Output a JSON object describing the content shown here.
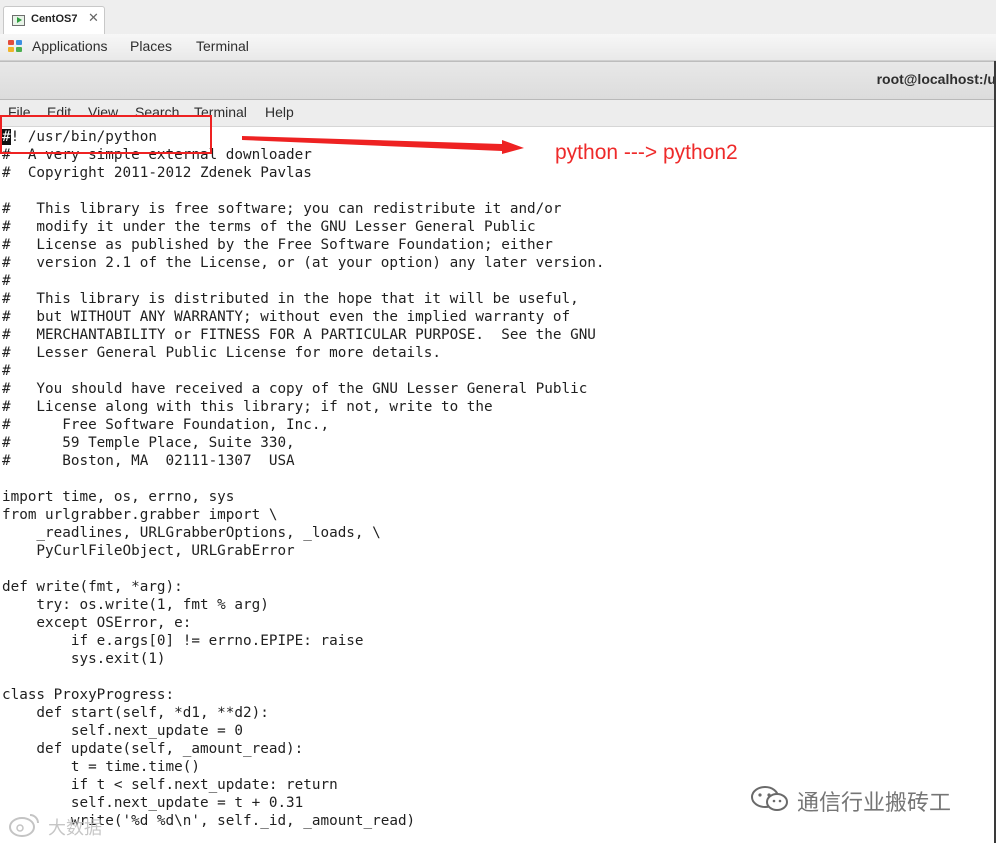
{
  "vm_tab": {
    "label": "CentOS7",
    "close_glyph": "✕"
  },
  "panel": {
    "applications": "Applications",
    "places": "Places",
    "terminal": "Terminal"
  },
  "window": {
    "title": "root@localhost:/u"
  },
  "menu": [
    "File",
    "Edit",
    "View",
    "Search",
    "Terminal",
    "Help"
  ],
  "terminal": {
    "cursor_char": "#",
    "lines": [
      "! /usr/bin/python",
      "#  A very simple external downloader",
      "#  Copyright 2011-2012 Zdenek Pavlas",
      "",
      "#   This library is free software; you can redistribute it and/or",
      "#   modify it under the terms of the GNU Lesser General Public",
      "#   License as published by the Free Software Foundation; either",
      "#   version 2.1 of the License, or (at your option) any later version.",
      "#",
      "#   This library is distributed in the hope that it will be useful,",
      "#   but WITHOUT ANY WARRANTY; without even the implied warranty of",
      "#   MERCHANTABILITY or FITNESS FOR A PARTICULAR PURPOSE.  See the GNU",
      "#   Lesser General Public License for more details.",
      "#",
      "#   You should have received a copy of the GNU Lesser General Public",
      "#   License along with this library; if not, write to the",
      "#      Free Software Foundation, Inc.,",
      "#      59 Temple Place, Suite 330,",
      "#      Boston, MA  02111-1307  USA",
      "",
      "import time, os, errno, sys",
      "from urlgrabber.grabber import \\",
      "    _readlines, URLGrabberOptions, _loads, \\",
      "    PyCurlFileObject, URLGrabError",
      "",
      "def write(fmt, *arg):",
      "    try: os.write(1, fmt % arg)",
      "    except OSError, e:",
      "        if e.args[0] != errno.EPIPE: raise",
      "        sys.exit(1)",
      "",
      "class ProxyProgress:",
      "    def start(self, *d1, **d2):",
      "        self.next_update = 0",
      "    def update(self, _amount_read):",
      "        t = time.time()",
      "        if t < self.next_update: return",
      "        self.next_update = t + 0.31",
      "        write('%d %d\\n', self._id, _amount_read)"
    ]
  },
  "annotation": {
    "text": "python ---> python2",
    "color": "#ee2a2a"
  },
  "watermarks": {
    "right": "通信行业搬砖工",
    "left": "大数据"
  },
  "icons": {
    "vm": "vm-console-icon",
    "applications": "applications-menu-icon",
    "arrow": "red-arrow",
    "wechat": "wechat-icon",
    "weibo": "weibo-icon"
  }
}
